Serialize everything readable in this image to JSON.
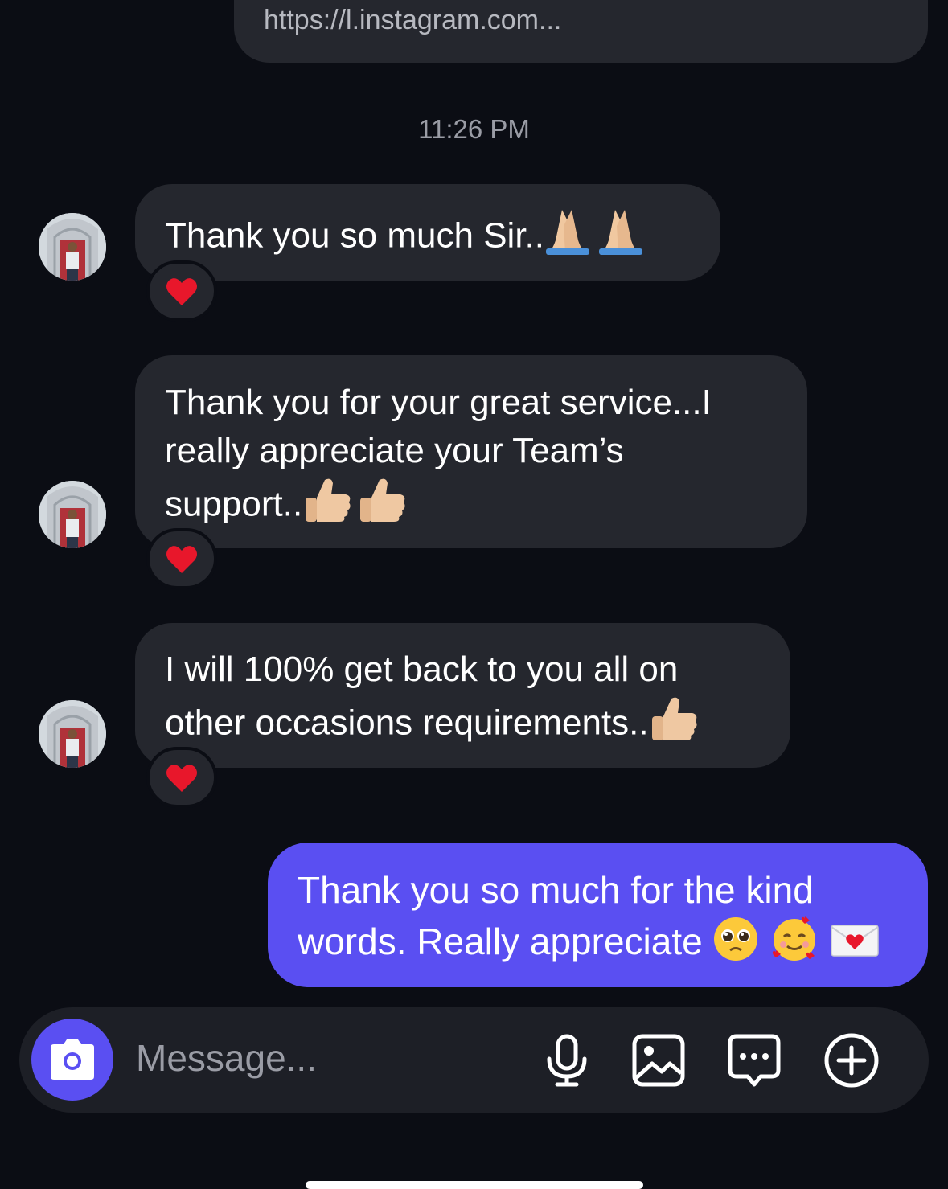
{
  "link_preview": {
    "url": "https://l.instagram.com..."
  },
  "timestamp": "11:26 PM",
  "messages_in": [
    {
      "lines": [
        "Thank you so much Sir.."
      ],
      "emojis": "folded-hands x2",
      "reaction": "heart"
    },
    {
      "lines": [
        "Thank you for your great service...I",
        "really appreciate your Team’s",
        "support.."
      ],
      "emojis": "thumbs-up x2",
      "reaction": "heart"
    },
    {
      "lines": [
        "I will 100% get back to you all on",
        "other occasions requirements.."
      ],
      "emojis": "thumbs-up x1",
      "reaction": "heart"
    }
  ],
  "message_out": {
    "lines": [
      "Thank you so much for the kind",
      "words. Really appreciate"
    ],
    "emojis": "pleading-face, smiling-face-with-hearts, love-letter"
  },
  "composer": {
    "placeholder": "Message...",
    "icons": [
      "camera-icon",
      "microphone-icon",
      "gallery-icon",
      "sticker-icon",
      "plus-icon"
    ]
  },
  "colors": {
    "background": "#0b0d14",
    "incoming_bubble": "#25272e",
    "outgoing_bubble": "#5a4ff2",
    "reaction_heart": "#e8172b"
  }
}
